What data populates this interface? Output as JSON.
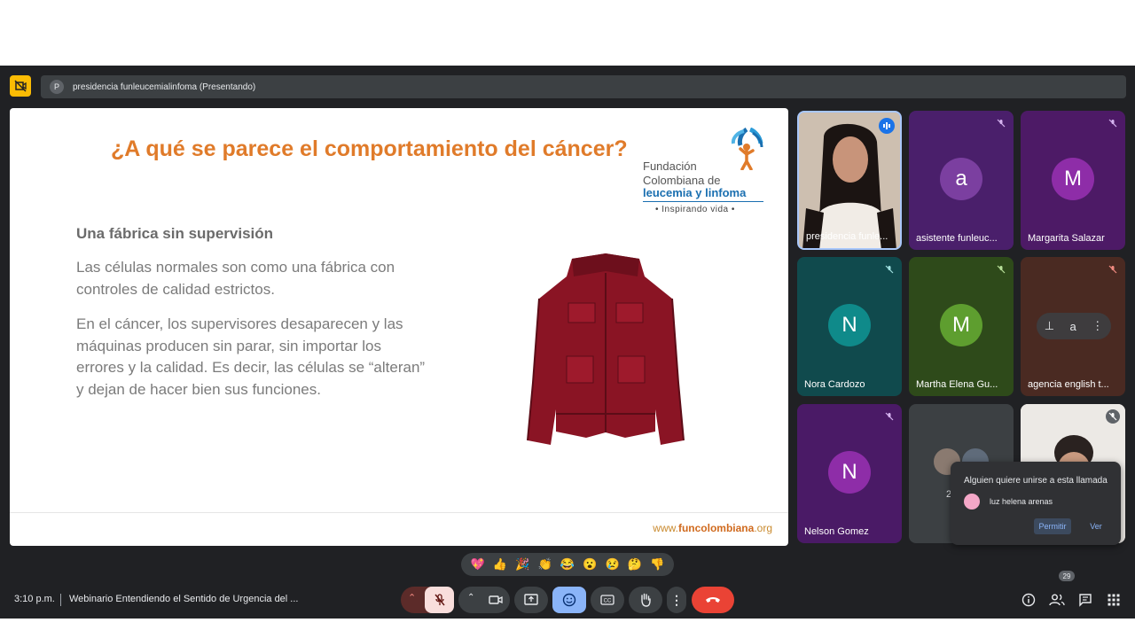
{
  "presenter_bar": {
    "avatar_letter": "P",
    "text": "presidencia funleucemialinfoma (Presentando)"
  },
  "slide": {
    "title": "¿A qué se parece el comportamiento del cáncer?",
    "logo": {
      "line1": "Fundación",
      "line2": "Colombiana de",
      "line3": "leucemia y linfoma",
      "tagline": "• Inspirando vida •"
    },
    "subheading": "Una fábrica sin supervisión",
    "paragraph1": "Las células normales son como una fábrica con controles de calidad estrictos.",
    "paragraph2": "En el cáncer, los supervisores desaparecen y las máquinas producen sin parar, sin importar los errores y la calidad. Es decir, las células se “alteran” y dejan de hacer bien sus funciones.",
    "url_prefix": "www.",
    "url_bold": "funcolombiana",
    "url_suffix": ".org"
  },
  "participants": [
    {
      "name": "presidencia funle...",
      "type": "video",
      "mic": "speaking"
    },
    {
      "name": "asistente funleuc...",
      "avatar": "a",
      "avatar_color": "#7b3fa0",
      "bg": "#4a1f6b",
      "mic": "muted"
    },
    {
      "name": "Margarita Salazar",
      "avatar": "M",
      "avatar_color": "#8e2da8",
      "bg": "#4d1a66",
      "mic": "muted"
    },
    {
      "name": "Nora Cardozo",
      "avatar": "N",
      "avatar_color": "#0f8a8a",
      "bg": "#104a4d",
      "mic": "muted"
    },
    {
      "name": "Martha Elena Gu...",
      "avatar": "M",
      "avatar_color": "#5e9e2f",
      "bg": "#2e4a1a",
      "mic": "muted"
    },
    {
      "name": "agencia english t...",
      "avatar": "a",
      "bg": "#4a2a22",
      "mic": "muted-red"
    },
    {
      "name": "Nelson Gomez",
      "avatar": "N",
      "avatar_color": "#8e2da8",
      "bg": "#4a1a66",
      "mic": "muted"
    },
    {
      "name": "2",
      "type": "others"
    },
    {
      "name": "",
      "type": "video-light"
    }
  ],
  "notification": {
    "title": "Alguien quiere unirse a esta llamada",
    "user": "luz helena arenas",
    "allow": "Permitir",
    "view": "Ver"
  },
  "reactions": [
    "💖",
    "👍",
    "🎉",
    "👏",
    "😂",
    "😮",
    "😢",
    "🤔",
    "👎"
  ],
  "bottom": {
    "time": "3:10 p.m.",
    "meeting_title": "Webinario Entendiendo el Sentido de Urgencia del ...",
    "participant_count": "29"
  },
  "colors": {
    "mic_off": "#f9dedc",
    "reactions_active": "#8ab4f8",
    "end_call": "#ea4335"
  }
}
